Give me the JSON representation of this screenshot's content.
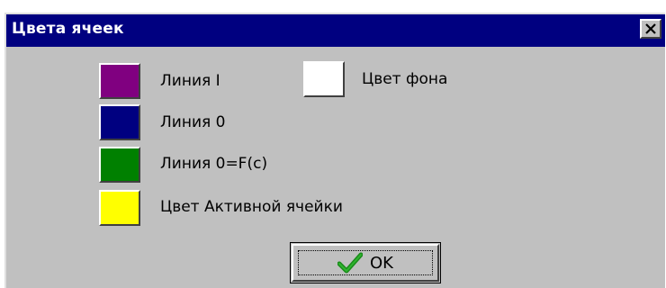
{
  "window": {
    "title": "Цвета ячеек",
    "close_icon": "close-x-icon"
  },
  "colors": [
    {
      "label": "Линия I",
      "color": "#800080"
    },
    {
      "label": "Линия 0",
      "color": "#000080"
    },
    {
      "label": "Линия 0=F(c)",
      "color": "#008000"
    },
    {
      "label": "Цвет Активной ячейки",
      "color": "#ffff00"
    },
    {
      "label": "Цвет фона",
      "color": "#ffffff"
    }
  ],
  "ok_button": {
    "label": "OK",
    "icon": "checkmark-icon"
  }
}
